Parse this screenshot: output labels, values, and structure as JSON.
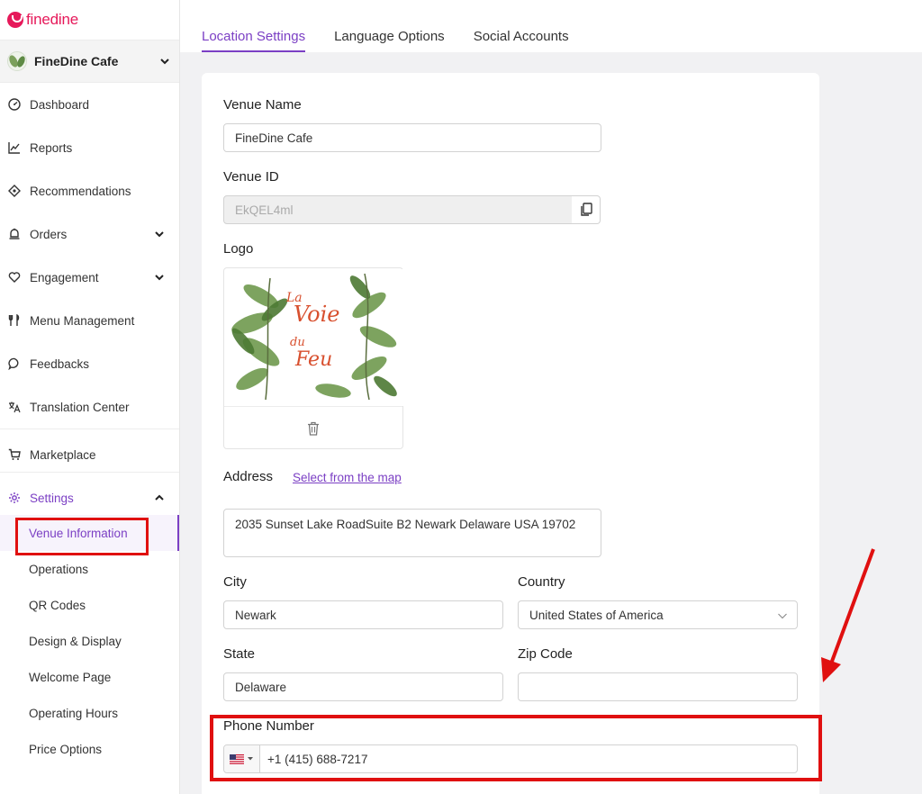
{
  "brand": {
    "name": "finedine"
  },
  "venue_switcher": {
    "name": "FineDine Cafe"
  },
  "sidebar": {
    "items": [
      {
        "label": "Dashboard",
        "icon": "dashboard-icon"
      },
      {
        "label": "Reports",
        "icon": "chart-line-icon"
      },
      {
        "label": "Recommendations",
        "icon": "recommendations-icon"
      },
      {
        "label": "Orders",
        "icon": "bell-icon"
      },
      {
        "label": "Engagement",
        "icon": "heart-icon"
      },
      {
        "label": "Menu Management",
        "icon": "fork-knife-icon"
      },
      {
        "label": "Feedbacks",
        "icon": "chat-icon"
      },
      {
        "label": "Translation Center",
        "icon": "translate-icon"
      },
      {
        "label": "Marketplace",
        "icon": "cart-icon"
      },
      {
        "label": "Settings",
        "icon": "gear-icon"
      }
    ],
    "settings_sub": [
      {
        "label": "Venue Information"
      },
      {
        "label": "Operations"
      },
      {
        "label": "QR Codes"
      },
      {
        "label": "Design & Display"
      },
      {
        "label": "Welcome Page"
      },
      {
        "label": "Operating Hours"
      },
      {
        "label": "Price Options"
      }
    ]
  },
  "tabs": [
    {
      "label": "Location Settings",
      "active": true
    },
    {
      "label": "Language Options",
      "active": false
    },
    {
      "label": "Social Accounts",
      "active": false
    }
  ],
  "form": {
    "venue_name": {
      "label": "Venue Name",
      "value": "FineDine Cafe"
    },
    "venue_id": {
      "label": "Venue ID",
      "value": "EkQEL4ml"
    },
    "logo": {
      "label": "Logo",
      "text_line1": "La",
      "text_line2": "Voie",
      "text_line3": "du",
      "text_line4": "Feu"
    },
    "address": {
      "label": "Address",
      "map_link": "Select from the map",
      "value": "2035 Sunset Lake RoadSuite B2 Newark Delaware USA 19702"
    },
    "city": {
      "label": "City",
      "value": "Newark"
    },
    "country": {
      "label": "Country",
      "value": "United States of America"
    },
    "state": {
      "label": "State",
      "value": "Delaware"
    },
    "zip": {
      "label": "Zip Code",
      "value": ""
    },
    "phone": {
      "label": "Phone Number",
      "value": "+1 (415) 688-7217",
      "flag": "us-flag-icon"
    }
  },
  "colors": {
    "accent": "#7b3fc4",
    "brand": "#e6195a",
    "annotation": "#e01010"
  }
}
